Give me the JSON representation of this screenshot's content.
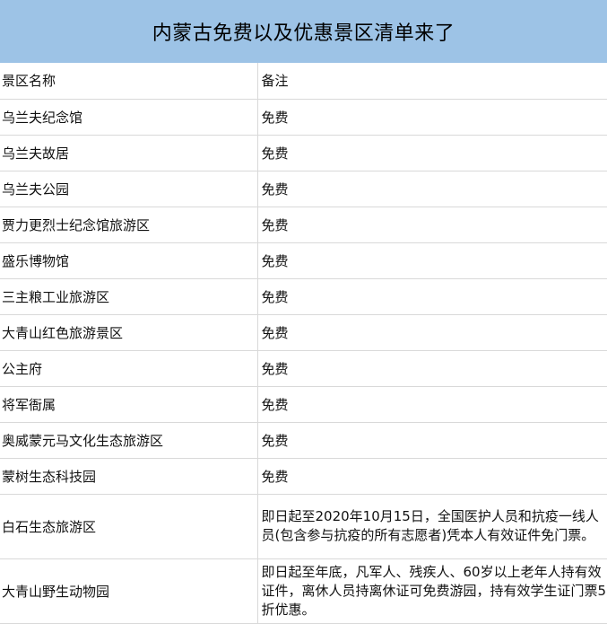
{
  "title": "内蒙古免费以及优惠景区清单来了",
  "header": {
    "name": "景区名称",
    "note": "备注"
  },
  "rows": [
    {
      "name": "乌兰夫纪念馆",
      "note": "免费"
    },
    {
      "name": "乌兰夫故居",
      "note": "免费"
    },
    {
      "name": "乌兰夫公园",
      "note": "免费"
    },
    {
      "name": "贾力更烈士纪念馆旅游区",
      "note": "免费"
    },
    {
      "name": "盛乐博物馆",
      "note": "免费"
    },
    {
      "name": "三主粮工业旅游区",
      "note": "免费"
    },
    {
      "name": "大青山红色旅游景区",
      "note": "免费"
    },
    {
      "name": "公主府",
      "note": "免费"
    },
    {
      "name": "将军衙属",
      "note": "免费"
    },
    {
      "name": "奥威蒙元马文化生态旅游区",
      "note": "免费"
    },
    {
      "name": "蒙树生态科技园",
      "note": "免费"
    },
    {
      "name": "白石生态旅游区",
      "note": "即日起至2020年10月15日，全国医护人员和抗疫一线人员(包含参与抗疫的所有志愿者)凭本人有效证件免门票。"
    },
    {
      "name": "大青山野生动物园",
      "note": "即日起至年底，凡军人、残疾人、60岁以上老年人持有效证件，离休人员持离休证可免费游园，持有效学生证门票5折优惠。"
    }
  ]
}
